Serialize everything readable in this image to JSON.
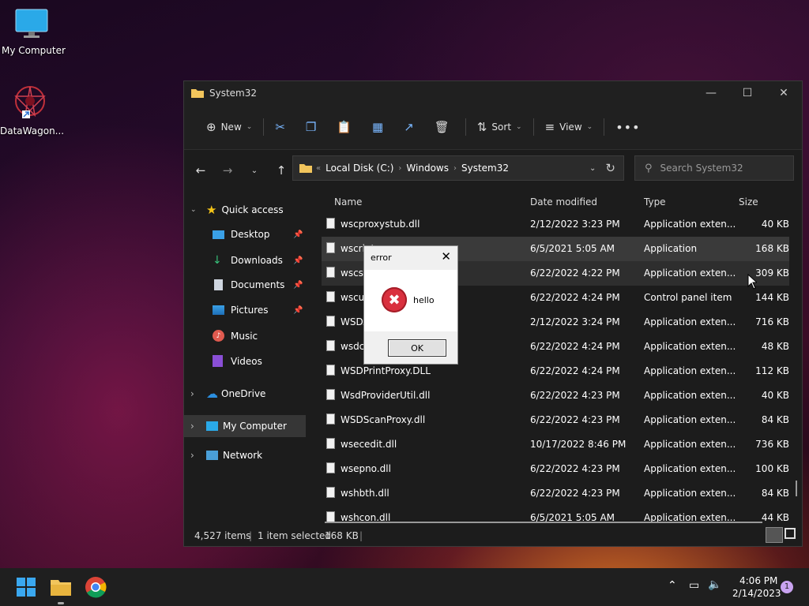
{
  "desktop": {
    "icons": [
      {
        "label": "My Computer"
      },
      {
        "label": "DataWagon..."
      }
    ]
  },
  "explorer": {
    "title": "System32",
    "toolbar": {
      "new_label": "New",
      "sort_label": "Sort",
      "view_label": "View"
    },
    "address": {
      "crumbs": [
        "Local Disk (C:)",
        "Windows",
        "System32"
      ]
    },
    "search": {
      "placeholder": "Search System32"
    },
    "nav": {
      "quick_access": "Quick access",
      "items": [
        "Desktop",
        "Downloads",
        "Documents",
        "Pictures",
        "Music",
        "Videos"
      ],
      "onedrive": "OneDrive",
      "my_computer": "My Computer",
      "network": "Network"
    },
    "columns": [
      "Name",
      "Date modified",
      "Type",
      "Size"
    ],
    "files": [
      {
        "name": "wscproxystub.dll",
        "date": "2/12/2022 3:23 PM",
        "type": "Application exten...",
        "size": "40 KB"
      },
      {
        "name": "wscript",
        "date": "6/5/2021 5:05 AM",
        "type": "Application",
        "size": "168 KB"
      },
      {
        "name": "wscsv",
        "date": "6/22/2022 4:22 PM",
        "type": "Application exten...",
        "size": "309 KB"
      },
      {
        "name": "wscui",
        "date": "6/22/2022 4:24 PM",
        "type": "Control panel item",
        "size": "144 KB"
      },
      {
        "name": "WSDA",
        "date": "2/12/2022 3:24 PM",
        "type": "Application exten...",
        "size": "716 KB"
      },
      {
        "name": "wsdcl",
        "date": "6/22/2022 4:24 PM",
        "type": "Application exten...",
        "size": "48 KB"
      },
      {
        "name": "WSDPrintProxy.DLL",
        "date": "6/22/2022 4:24 PM",
        "type": "Application exten...",
        "size": "112 KB"
      },
      {
        "name": "WsdProviderUtil.dll",
        "date": "6/22/2022 4:23 PM",
        "type": "Application exten...",
        "size": "40 KB"
      },
      {
        "name": "WSDScanProxy.dll",
        "date": "6/22/2022 4:23 PM",
        "type": "Application exten...",
        "size": "84 KB"
      },
      {
        "name": "wsecedit.dll",
        "date": "10/17/2022 8:46 PM",
        "type": "Application exten...",
        "size": "736 KB"
      },
      {
        "name": "wsepno.dll",
        "date": "6/22/2022 4:23 PM",
        "type": "Application exten...",
        "size": "100 KB"
      },
      {
        "name": "wshbth.dll",
        "date": "6/22/2022 4:23 PM",
        "type": "Application exten...",
        "size": "84 KB"
      },
      {
        "name": "wshcon.dll",
        "date": "6/5/2021 5:05 AM",
        "type": "Application exten...",
        "size": "44 KB"
      }
    ],
    "status": {
      "count": "4,527 items",
      "selected": "1 item selected",
      "size": "168 KB"
    }
  },
  "dialog": {
    "title": "error",
    "message": "hello",
    "ok_label": "OK"
  },
  "taskbar": {
    "time": "4:06 PM",
    "date": "2/14/2023",
    "notification_count": "1"
  },
  "colors": {
    "accent": "#0078d4",
    "error": "#d9303e",
    "folder": "#f2c55c"
  }
}
